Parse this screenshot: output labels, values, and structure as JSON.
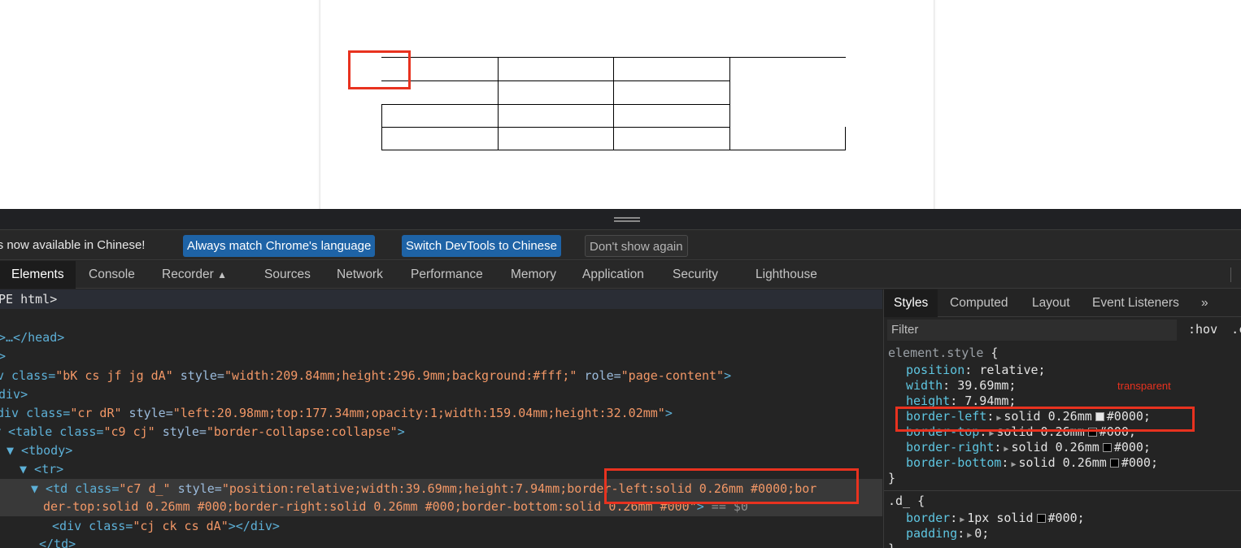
{
  "devtools": {
    "infobar": {
      "message": "ols is now available in Chinese!",
      "btn_match": "Always match Chrome's language",
      "btn_switch": "Switch DevTools to Chinese",
      "btn_dont_show": "Don't show again"
    },
    "tabs": {
      "elements": "Elements",
      "console": "Console",
      "recorder": "Recorder",
      "sources": "Sources",
      "network": "Network",
      "performance": "Performance",
      "memory": "Memory",
      "application": "Application",
      "security": "Security",
      "lighthouse": "Lighthouse"
    },
    "elements_tree": {
      "l0": "PE html>",
      "l1_tag": ">…</head>",
      "l2": ">",
      "l3_pre": "v class=",
      "l3_cls": "\"bK cs jf jg dA\"",
      "l3_style_attr": " style=",
      "l3_style": "\"width:209.84mm;height:296.9mm;background:#fff;\"",
      "l3_role_attr": " role=",
      "l3_role": "\"page-content\"",
      "l3_end": ">",
      "l4": "div>",
      "l5_pre": "div class=",
      "l5_cls": "\"cr dR\"",
      "l5_style_attr": " style=",
      "l5_style": "\"left:20.98mm;top:177.34mm;opacity:1;width:159.04mm;height:32.02mm\"",
      "l5_end": ">",
      "l6_pre": "▼ <table class=",
      "l6_cls": "\"c9 cj\"",
      "l6_style_attr": " style=",
      "l6_style": "\"border-collapse:collapse\"",
      "l6_end": ">",
      "l7": "▼ <tbody>",
      "l8": "▼ <tr>",
      "l9_pre": "▼ <td class=",
      "l9_cls": "\"c7 d_\"",
      "l9_style_attr": " style=",
      "l9_style": "\"position:relative;width:39.69mm;height:7.94mm;border-left:solid 0.26mm #0000;bor",
      "l10_style": "der-top:solid 0.26mm #000;border-right:solid 0.26mm #000;border-bottom:solid 0.26mm #000\"",
      "l10_end": ">",
      "l10_ref": " == $0",
      "l11_pre": "<div class=",
      "l11_cls": "\"cj ck cs dA\"",
      "l11_end": "></div>",
      "l12": "</td>"
    },
    "styles": {
      "tabs": {
        "styles": "Styles",
        "computed": "Computed",
        "layout": "Layout",
        "event_listeners": "Event Listeners",
        "more": "»"
      },
      "filter_placeholder": "Filter",
      "hov": ":hov",
      "cls": ".c",
      "element_style_selector": "element.style",
      "open_brace": " {",
      "close_brace": "}",
      "rules": [
        {
          "prop": "position",
          "val": "relative;"
        },
        {
          "prop": "width",
          "val": "39.69mm;"
        },
        {
          "prop": "height",
          "val": "7.94mm;"
        },
        {
          "prop": "border-left",
          "val_pre": "solid 0.26mm",
          "val_color": "#0000;"
        },
        {
          "prop": "border-top",
          "val_pre": "solid 0.26mm",
          "val_color": "#000;"
        },
        {
          "prop": "border-right",
          "val_pre": "solid 0.26mm",
          "val_color": "#000;"
        },
        {
          "prop": "border-bottom",
          "val_pre": "solid 0.26mm",
          "val_color": "#000;"
        }
      ],
      "annotation": "transparent",
      "d_selector": ".d_",
      "d_rules": [
        {
          "prop": "border",
          "val_pre": "1px solid",
          "val_color": "#000;"
        },
        {
          "prop": "padding",
          "val": "0;"
        }
      ]
    }
  },
  "colors": {
    "highlight": "#e8321f",
    "accent_button": "#1e63a6"
  }
}
